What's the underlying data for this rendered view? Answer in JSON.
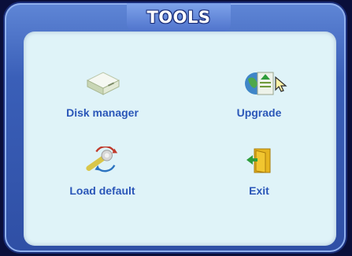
{
  "window": {
    "title": "TOOLS"
  },
  "items": [
    {
      "label": "Disk manager",
      "icon": "disk-drive-icon"
    },
    {
      "label": "Upgrade",
      "icon": "globe-upload-icon"
    },
    {
      "label": "Load default",
      "icon": "wrench-reset-icon"
    },
    {
      "label": "Exit",
      "icon": "exit-door-icon"
    }
  ],
  "colors": {
    "frame": "#3a5fb8",
    "panel": "#dff3f8",
    "label": "#2a56b8"
  }
}
